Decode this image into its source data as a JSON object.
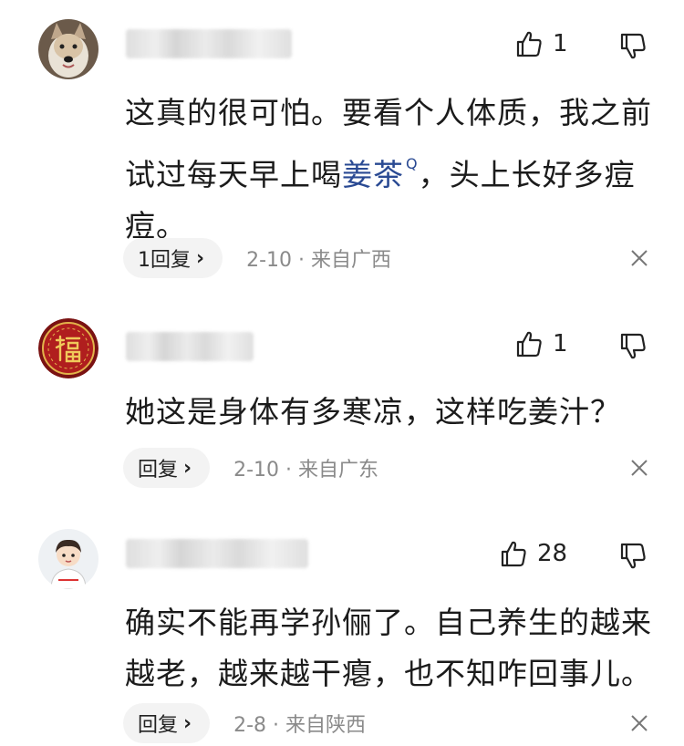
{
  "comments": [
    {
      "likes": "1",
      "text_parts": [
        "这真的很可怕。要看个人体质，我之前试过每天早上喝",
        "姜茶",
        "，头上长好多痘痘。"
      ],
      "reply_label": "1回复",
      "date": "2-10",
      "location": "来自广西",
      "avatar": "dog-avatar"
    },
    {
      "likes": "1",
      "text": "她这是身体有多寒凉，这样吃姜汁？",
      "reply_label": "回复",
      "date": "2-10",
      "location": "来自广东",
      "avatar": "fu-character-avatar"
    },
    {
      "likes": "28",
      "text": "确实不能再学孙俪了。自己养生的越来越老，越来越干瘪，也不知咋回事儿。",
      "reply_label": "回复",
      "date": "2-8",
      "location": "来自陕西",
      "avatar": "cartoon-boy-avatar"
    }
  ],
  "icons": {
    "like": "thumbs-up-icon",
    "dislike": "thumbs-down-icon",
    "reply_chevron": "chevron-right-icon",
    "close": "close-icon",
    "search": "search-icon"
  },
  "colors": {
    "link": "#2a4a93",
    "meta": "#8a8a8a",
    "reply_pill_bg": "#f3f3f3"
  },
  "meta_separator": "·",
  "chevron_glyph": "›",
  "search_glyph": "Q"
}
